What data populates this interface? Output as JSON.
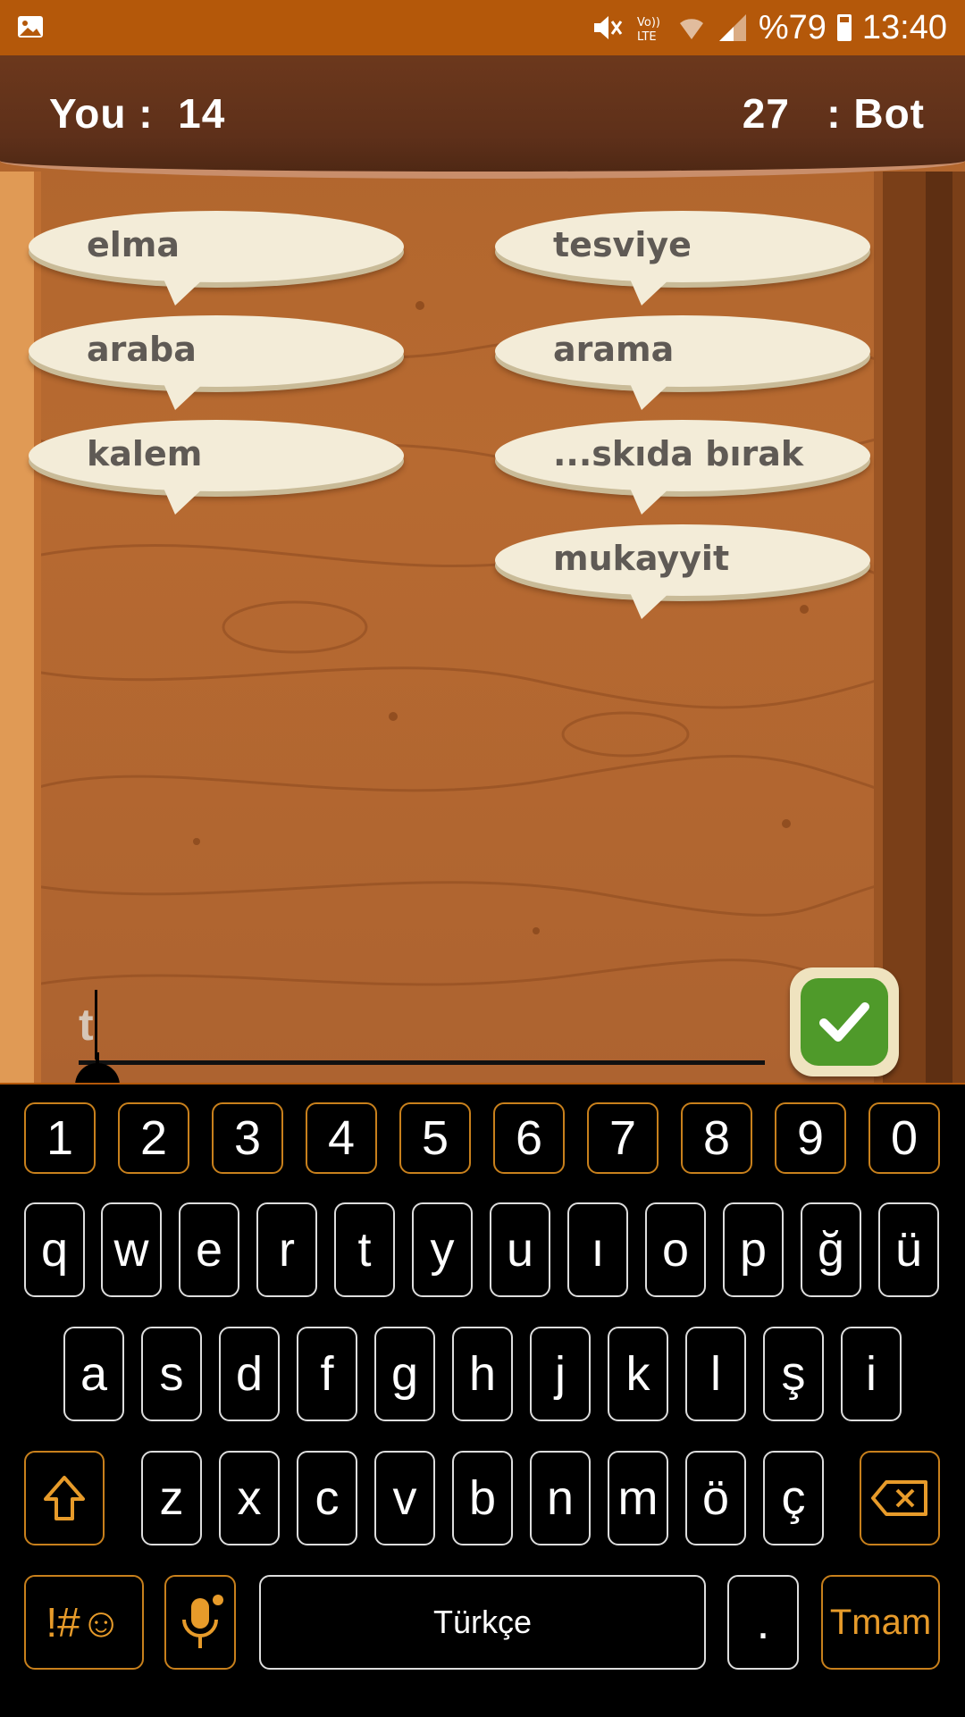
{
  "status_bar": {
    "battery_percent": "%79",
    "time": "13:40",
    "icons": [
      "image-icon",
      "mute-icon",
      "volte-icon",
      "wifi-icon",
      "signal-icon",
      "battery-icon"
    ]
  },
  "game": {
    "you_label": "You :",
    "you_score": "14",
    "bot_score": "27",
    "bot_label": ": Bot",
    "player_words": [
      "elma",
      "araba",
      "kalem"
    ],
    "bot_words": [
      "tesviye",
      "arama",
      "...skıda bırak",
      "mukayyit"
    ],
    "input_value": "t",
    "submit_icon": "check-icon"
  },
  "keyboard": {
    "number_row": [
      "1",
      "2",
      "3",
      "4",
      "5",
      "6",
      "7",
      "8",
      "9",
      "0"
    ],
    "row1": [
      "q",
      "w",
      "e",
      "r",
      "t",
      "y",
      "u",
      "ı",
      "o",
      "p",
      "ğ",
      "ü"
    ],
    "row2": [
      "a",
      "s",
      "d",
      "f",
      "g",
      "h",
      "j",
      "k",
      "l",
      "ş",
      "i"
    ],
    "row3": [
      "z",
      "x",
      "c",
      "v",
      "b",
      "n",
      "m",
      "ö",
      "ç"
    ],
    "symbols_label": "!#☺",
    "space_label": "Türkçe",
    "period_label": ".",
    "done_label": "Tmam",
    "accent_color": "#e79b2a"
  }
}
